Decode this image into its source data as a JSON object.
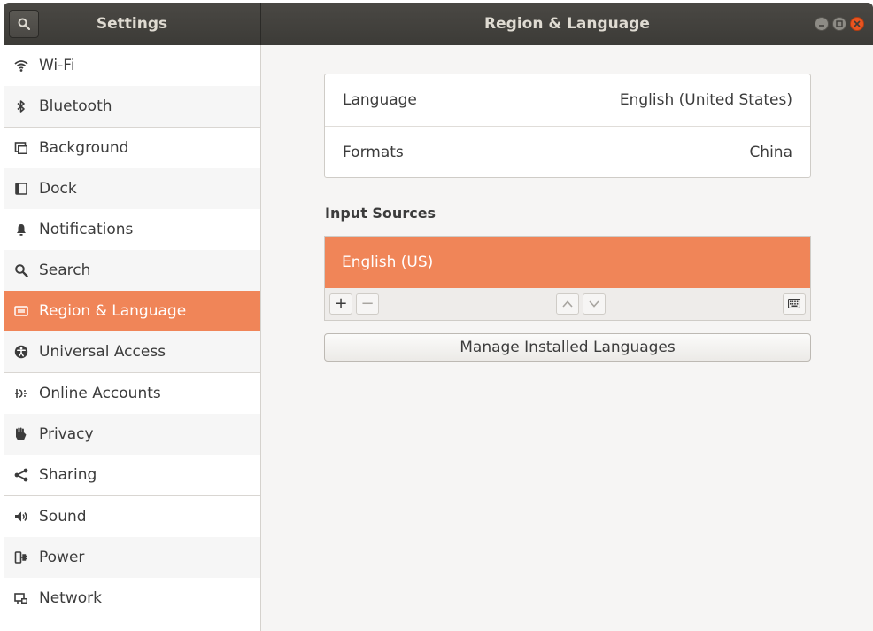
{
  "header": {
    "sidebar_title": "Settings",
    "panel_title": "Region & Language"
  },
  "sidebar": {
    "items": [
      {
        "label": "Wi-Fi",
        "icon": "wifi-icon"
      },
      {
        "label": "Bluetooth",
        "icon": "bluetooth-icon"
      },
      {
        "label": "Background",
        "icon": "background-icon"
      },
      {
        "label": "Dock",
        "icon": "dock-icon"
      },
      {
        "label": "Notifications",
        "icon": "bell-icon"
      },
      {
        "label": "Search",
        "icon": "search-icon"
      },
      {
        "label": "Region & Language",
        "icon": "region-language-icon",
        "selected": true
      },
      {
        "label": "Universal Access",
        "icon": "universal-access-icon"
      },
      {
        "label": "Online Accounts",
        "icon": "online-accounts-icon"
      },
      {
        "label": "Privacy",
        "icon": "hand-icon"
      },
      {
        "label": "Sharing",
        "icon": "share-icon"
      },
      {
        "label": "Sound",
        "icon": "speaker-icon"
      },
      {
        "label": "Power",
        "icon": "power-icon"
      },
      {
        "label": "Network",
        "icon": "network-icon"
      }
    ]
  },
  "region": {
    "language_label": "Language",
    "language_value": "English (United States)",
    "formats_label": "Formats",
    "formats_value": "China"
  },
  "input_sources": {
    "title": "Input Sources",
    "items": [
      "English (US)"
    ],
    "add_label": "+",
    "remove_label": "−"
  },
  "manage_button": "Manage Installed Languages",
  "colors": {
    "accent": "#f08558",
    "header": "#3c3b37",
    "close": "#e95420"
  }
}
